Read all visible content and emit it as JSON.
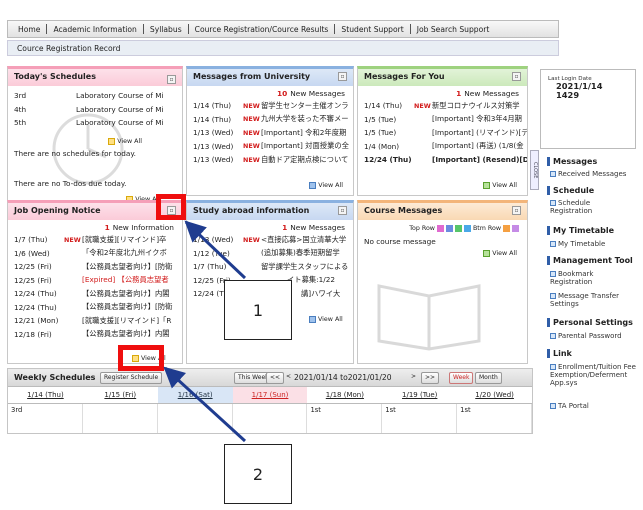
{
  "nav": {
    "items": [
      "Home",
      "Academic Information",
      "Syllabus",
      "Cource Registration/Cource Results",
      "Student Support",
      "Job Search Support"
    ]
  },
  "breadcrumb": "Cource Registration Record",
  "todays_schedules": {
    "title": "Today's Schedules",
    "rows": [
      {
        "period": "3rd",
        "text": "Laboratory Course of Mi"
      },
      {
        "period": "4th",
        "text": "Laboratory Course of Mi"
      },
      {
        "period": "5th",
        "text": "Laboratory Course of Mi"
      }
    ],
    "view_all": "View All",
    "no_schedules": "There are no schedules for today.",
    "no_todos": "There are no To-dos due today.",
    "view_all_2": "View All"
  },
  "messages_university": {
    "title": "Messages from University",
    "count_num": "10",
    "count_label": "New Messages",
    "rows": [
      {
        "date": "1/14 (Thu)",
        "new": "NEW",
        "text": "留学生センター主催オンラ"
      },
      {
        "date": "1/14 (Thu)",
        "new": "NEW",
        "text": "九州大学を装った不審メー"
      },
      {
        "date": "1/13 (Wed)",
        "new": "NEW",
        "text": "[Important] 令和2年度期"
      },
      {
        "date": "1/13 (Wed)",
        "new": "NEW",
        "text": "[Important] 対面授業の全"
      },
      {
        "date": "1/13 (Wed)",
        "new": "NEW",
        "text": "自動ドア定期点検について"
      }
    ],
    "view_all": "View All"
  },
  "messages_for_you": {
    "title": "Messages For You",
    "count_num": "1",
    "count_label": "New Messages",
    "rows": [
      {
        "date": "1/14 (Thu)",
        "new": "NEW",
        "text": "新型コロナウイルス対策学"
      },
      {
        "date": "1/5 (Tue)",
        "new": "",
        "text": "[Important] 令和3年4月期"
      },
      {
        "date": "1/5 (Tue)",
        "new": "",
        "text": "[Important] (リマインド)[デ"
      },
      {
        "date": "1/4 (Mon)",
        "new": "",
        "text": "[Important] (再送) (1/8(金"
      },
      {
        "date": "12/24 (Thu)",
        "new": "",
        "text": "[Important] (Resend)[Dai"
      }
    ],
    "view_all": "View All"
  },
  "job_opening": {
    "title": "Job Opening Notice",
    "count_num": "1",
    "count_label": "New Information",
    "rows": [
      {
        "date": "1/7 (Thu)",
        "new": "NEW",
        "text": "[就職支援][リマインド]卒",
        "red": false
      },
      {
        "date": "1/6 (Wed)",
        "new": "",
        "text": "「令和2年度北九州イクボ",
        "red": false
      },
      {
        "date": "12/25 (Fri)",
        "new": "",
        "text": "【公務員志望者向け】[防衛",
        "red": false
      },
      {
        "date": "12/25 (Fri)",
        "new": "",
        "text": "[Expired] 【公務員志望者",
        "red": true
      },
      {
        "date": "12/24 (Thu)",
        "new": "",
        "text": "【公務員志望者向け】内閣",
        "red": false
      },
      {
        "date": "12/24 (Thu)",
        "new": "",
        "text": "【公務員志望者向け】[防衛",
        "red": false
      },
      {
        "date": "12/21 (Mon)",
        "new": "",
        "text": "[就職支援][リマインド]「R",
        "red": false
      },
      {
        "date": "12/18 (Fri)",
        "new": "",
        "text": "【公務員志望者向け】内閣",
        "red": false
      }
    ],
    "view_all": "View All"
  },
  "study_abroad": {
    "title": "Study abroad information",
    "count_num": "1",
    "count_label": "New Messages",
    "rows": [
      {
        "date": "1/13 (Wed)",
        "new": "NEW",
        "text": "<直接応募>国立清華大学"
      },
      {
        "date": "1/12 (Tue)",
        "new": "",
        "text": "(追加募集)春季短期留学"
      },
      {
        "date": "1/7 (Thu)",
        "new": "",
        "text": "留学課学生スタッフによる"
      },
      {
        "date": "12/25 (Fri)",
        "new": "",
        "text": "イト募集:1/22"
      },
      {
        "date": "12/24 (Thu)",
        "new": "",
        "text": "講]ハワイ大"
      }
    ],
    "view_all": "View All"
  },
  "course_messages": {
    "title": "Course Messages",
    "top_label": "Top Row",
    "btm_label": "Btm Row",
    "no_message": "No course message",
    "view_all": "View All"
  },
  "last_login": {
    "label": "Last Login Date",
    "date": "2021/1/14",
    "time": "1429"
  },
  "close_tab": "CLOSE",
  "sidebar": {
    "messages": {
      "title": "Messages",
      "links": [
        "Received Messages"
      ]
    },
    "schedule": {
      "title": "Schedule",
      "links": [
        "Schedule Registration"
      ]
    },
    "timetable": {
      "title": "My Timetable",
      "links": [
        "My Timetable"
      ]
    },
    "management": {
      "title": "Management Tool",
      "links": [
        "Bookmark Registration",
        "Message Transfer Settings"
      ]
    },
    "personal": {
      "title": "Personal Settings",
      "links": [
        "Parental Password"
      ]
    },
    "link": {
      "title": "Link",
      "links": [
        "Enrollment/Tuition Fee Exemption/Deferment App.sys",
        "TA Portal"
      ]
    }
  },
  "weekly": {
    "title": "Weekly Schedules",
    "register_btn": "Register Schedule",
    "this_week": "This Week",
    "range": "2021/01/14 to2021/01/20",
    "week_btn": "Week",
    "month_btn": "Month",
    "days": [
      "1/14 (Thu)",
      "1/15 (Fri)",
      "1/16 (Sat)",
      "1/17 (Sun)",
      "1/18 (Mon)",
      "1/19 (Tue)",
      "1/20 (Wed)"
    ],
    "cells": [
      "3rd",
      "",
      "",
      "",
      "1st",
      "1st",
      "1st"
    ]
  },
  "callouts": [
    "1",
    "2"
  ],
  "colors": {
    "highlight": "#ef0e0e",
    "new_red": "#d21b1b",
    "accent_blue": "#305ea8"
  }
}
